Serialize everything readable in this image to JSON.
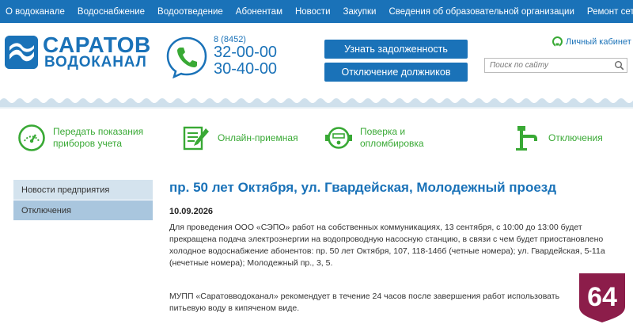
{
  "nav": {
    "items": [
      "О водоканале",
      "Водоснабжение",
      "Водоотведение",
      "Абонентам",
      "Новости",
      "Закупки",
      "Сведения об образовательной организации",
      "Ремонт сетей"
    ]
  },
  "header": {
    "logo_line1": "САРАТОВ",
    "logo_line2": "ВОДОКАНАЛ",
    "phone_code": "8 (8452)",
    "phone1": "32-00-00",
    "phone2": "30-40-00",
    "btn_debt": "Узнать задолженность",
    "btn_debtors": "Отключение должников",
    "cabinet_label": "Личный кабинет",
    "search_placeholder": "Поиск по сайту"
  },
  "services": [
    {
      "label": "Передать показания приборов учета",
      "icon": "gauge-icon"
    },
    {
      "label": "Онлайн-приемная",
      "icon": "document-pen-icon"
    },
    {
      "label": "Поверка и опломбировка",
      "icon": "water-meter-icon"
    },
    {
      "label": "Отключения",
      "icon": "faucet-icon"
    }
  ],
  "sidebar": {
    "items": [
      {
        "label": "Новости предприятия",
        "active": false
      },
      {
        "label": "Отключения",
        "active": true
      }
    ]
  },
  "article": {
    "title": "пр. 50 лет Октября, ул. Гвардейская, Молодежный проезд",
    "date": "10.09.2026",
    "paragraph1": "Для проведения ООО «СЭПО» работ на собственных коммуникациях, 13 сентября, с 10:00 до 13:00 будет прекращена подача электроэнергии на водопроводную насосную станцию, в связи с чем будет приостановлено холодное водоснабжение абонентов: пр. 50 лет Октября, 107, 118-146б (четные номера); ул. Гвардейская, 5-11а (нечетные номера); Молодежный пр., 3, 5.",
    "paragraph2": "МУПП «Саратовводоканал» рекомендует в течение 24 часов после завершения работ использовать питьевую воду в кипяченом виде."
  },
  "badge": {
    "text": "64"
  },
  "colors": {
    "primary": "#1a72b8",
    "green": "#39a935",
    "badge": "#8c1d4a",
    "sidebar": "#d4e3ee",
    "sidebar_active": "#a9c6de"
  }
}
